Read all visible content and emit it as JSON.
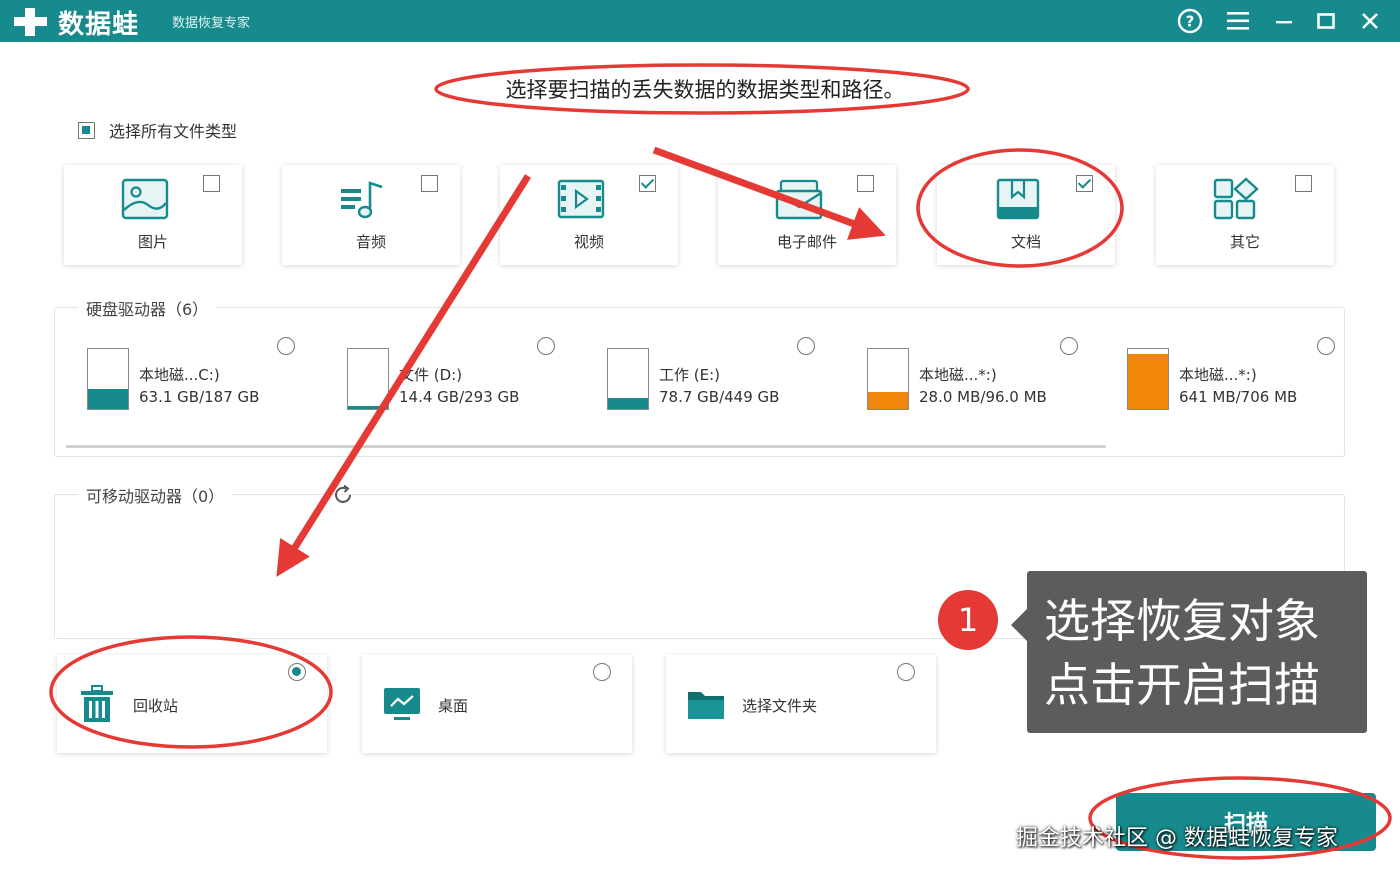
{
  "app": {
    "name": "数据蛙",
    "subtitle": "数据恢复专家"
  },
  "heading": "选择要扫描的丢失数据的数据类型和路径。",
  "select_all": {
    "label": "选择所有文件类型",
    "state": "partial"
  },
  "file_types": [
    {
      "label": "图片",
      "checked": false,
      "icon": "image-icon"
    },
    {
      "label": "音频",
      "checked": false,
      "icon": "music-icon"
    },
    {
      "label": "视频",
      "checked": true,
      "icon": "video-icon"
    },
    {
      "label": "电子邮件",
      "checked": false,
      "icon": "email-icon"
    },
    {
      "label": "文档",
      "checked": true,
      "icon": "document-icon"
    },
    {
      "label": "其它",
      "checked": false,
      "icon": "apps-icon"
    }
  ],
  "hard_drives": {
    "title": "硬盘驱动器（6）",
    "items": [
      {
        "name": "本地磁...C:)",
        "size": "63.1 GB/187 GB",
        "fill": 0.34,
        "color": "#168a8c"
      },
      {
        "name": "文件 (D:)",
        "size": "14.4 GB/293 GB",
        "fill": 0.05,
        "color": "#168a8c"
      },
      {
        "name": "工作 (E:)",
        "size": "78.7 GB/449 GB",
        "fill": 0.18,
        "color": "#168a8c"
      },
      {
        "name": "本地磁...*:)",
        "size": "28.0 MB/96.0 MB",
        "fill": 0.29,
        "color": "#f0870a"
      },
      {
        "name": "本地磁...*:)",
        "size": "641 MB/706 MB",
        "fill": 0.91,
        "color": "#f0870a"
      }
    ]
  },
  "removable": {
    "title": "可移动驱动器（0）",
    "refresh_icon": "refresh-icon"
  },
  "locations": [
    {
      "label": "回收站",
      "selected": true,
      "icon": "trash-icon"
    },
    {
      "label": "桌面",
      "selected": false,
      "icon": "desktop-icon"
    },
    {
      "label": "选择文件夹",
      "selected": false,
      "icon": "folder-icon"
    }
  ],
  "scan_button": "扫描",
  "callout": {
    "number": "1",
    "line1": "选择恢复对象",
    "line2": "点击开启扫描"
  },
  "watermark": "掘金技术社区 @ 数据蛙恢复专家",
  "colors": {
    "accent": "#168a8c",
    "orange": "#f0870a",
    "annotation": "#e53935"
  }
}
